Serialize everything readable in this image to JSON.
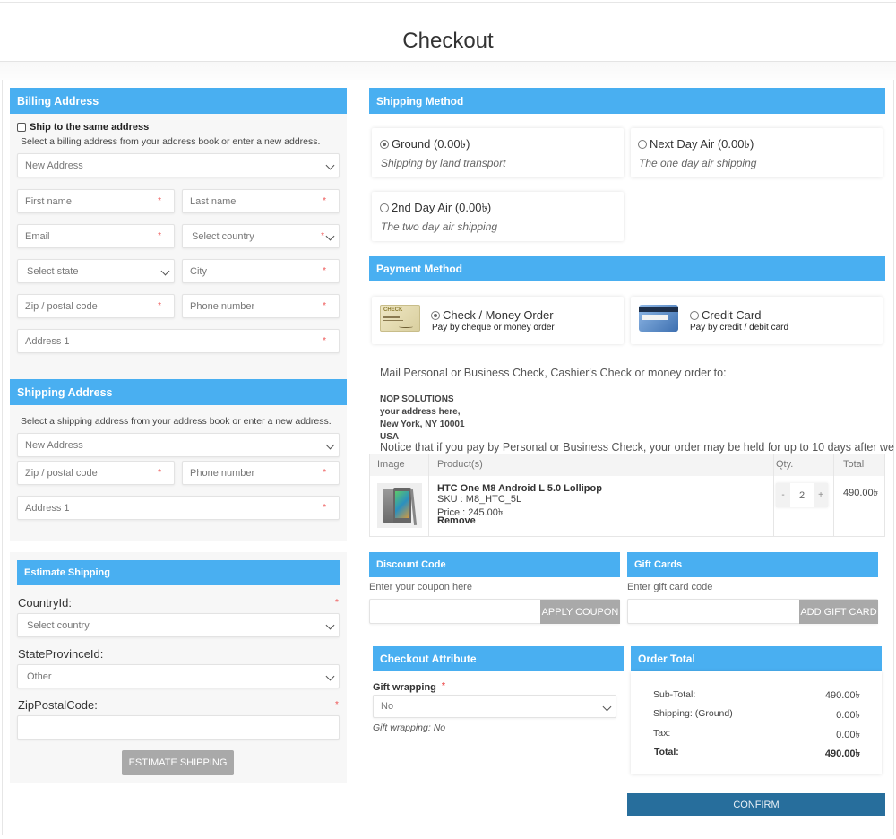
{
  "page": {
    "title": "Checkout"
  },
  "billing": {
    "header": "Billing Address",
    "same_address_label": "Ship to the same address",
    "hint": "Select a billing address from your address book or enter a new address.",
    "address_select": "New Address",
    "first_name": "First name",
    "last_name": "Last name",
    "email": "Email",
    "country": "Select country",
    "state": "Select state",
    "city": "City",
    "zip": "Zip / postal code",
    "phone": "Phone number",
    "address1": "Address 1",
    "required_mark": "*"
  },
  "shipping_address": {
    "header": "Shipping Address",
    "hint": "Select a shipping address from your address book or enter a new address.",
    "address_select": "New Address",
    "zip": "Zip / postal code",
    "phone": "Phone number",
    "address1": "Address 1"
  },
  "estimate": {
    "header": "Estimate Shipping",
    "country_label": "CountryId:",
    "country_value": "Select country",
    "state_label": "StateProvinceId:",
    "state_value": "Other",
    "zip_label": "ZipPostalCode:",
    "zip_value": "",
    "button": "ESTIMATE SHIPPING"
  },
  "shipping_method": {
    "header": "Shipping Method",
    "options": [
      {
        "name": "Ground (0.00৳)",
        "desc": "Shipping by land transport",
        "selected": true
      },
      {
        "name": "Next Day Air (0.00৳)",
        "desc": "The one day air shipping",
        "selected": false
      },
      {
        "name": "2nd Day Air (0.00৳)",
        "desc": "The two day air shipping",
        "selected": false
      }
    ]
  },
  "payment_method": {
    "header": "Payment Method",
    "options": [
      {
        "name": "Check / Money Order",
        "desc": "Pay by cheque or money order",
        "icon": "check-icon",
        "selected": true
      },
      {
        "name": "Credit Card",
        "desc": "Pay by credit / debit card",
        "icon": "credit-card-icon",
        "selected": false
      }
    ],
    "info_intro": "Mail Personal or Business Check, Cashier's Check or money order to:",
    "address_lines": [
      "NOP SOLUTIONS",
      "your address here,",
      "New York, NY 10001",
      "USA"
    ],
    "notice": "Notice that if you pay by Personal or Business Check, your order may be held for up to 10 days after we"
  },
  "cart": {
    "columns": [
      "Image",
      "Product(s)",
      "Qty.",
      "Total"
    ],
    "items": [
      {
        "name": "HTC One M8 Android L 5.0 Lollipop",
        "sku": "SKU : M8_HTC_5L",
        "price": "Price : 245.00৳",
        "remove": "Remove",
        "qty": "2",
        "total": "490.00৳"
      }
    ],
    "minus": "-",
    "plus": "+"
  },
  "discount": {
    "header": "Discount Code",
    "hint": "Enter your coupon here",
    "value": "",
    "button": "APPLY COUPON"
  },
  "giftcard": {
    "header": "Gift Cards",
    "hint": "Enter gift card code",
    "value": "",
    "button": "ADD GIFT CARD"
  },
  "checkout_attr": {
    "header": "Checkout Attribute",
    "label": "Gift wrapping",
    "required": "*",
    "value": "No",
    "summary": "Gift wrapping: No"
  },
  "order_total": {
    "header": "Order Total",
    "rows": [
      {
        "label": "Sub-Total:",
        "value": "490.00৳"
      },
      {
        "label": "Shipping: (Ground)",
        "value": "0.00৳"
      },
      {
        "label": "Tax:",
        "value": "0.00৳"
      },
      {
        "label": "Total:",
        "value": "490.00৳"
      }
    ]
  },
  "confirm_button": "CONFIRM",
  "colors": {
    "accent": "#49aff1",
    "confirm": "#276e9c",
    "button_gray": "#a9a9a9"
  }
}
